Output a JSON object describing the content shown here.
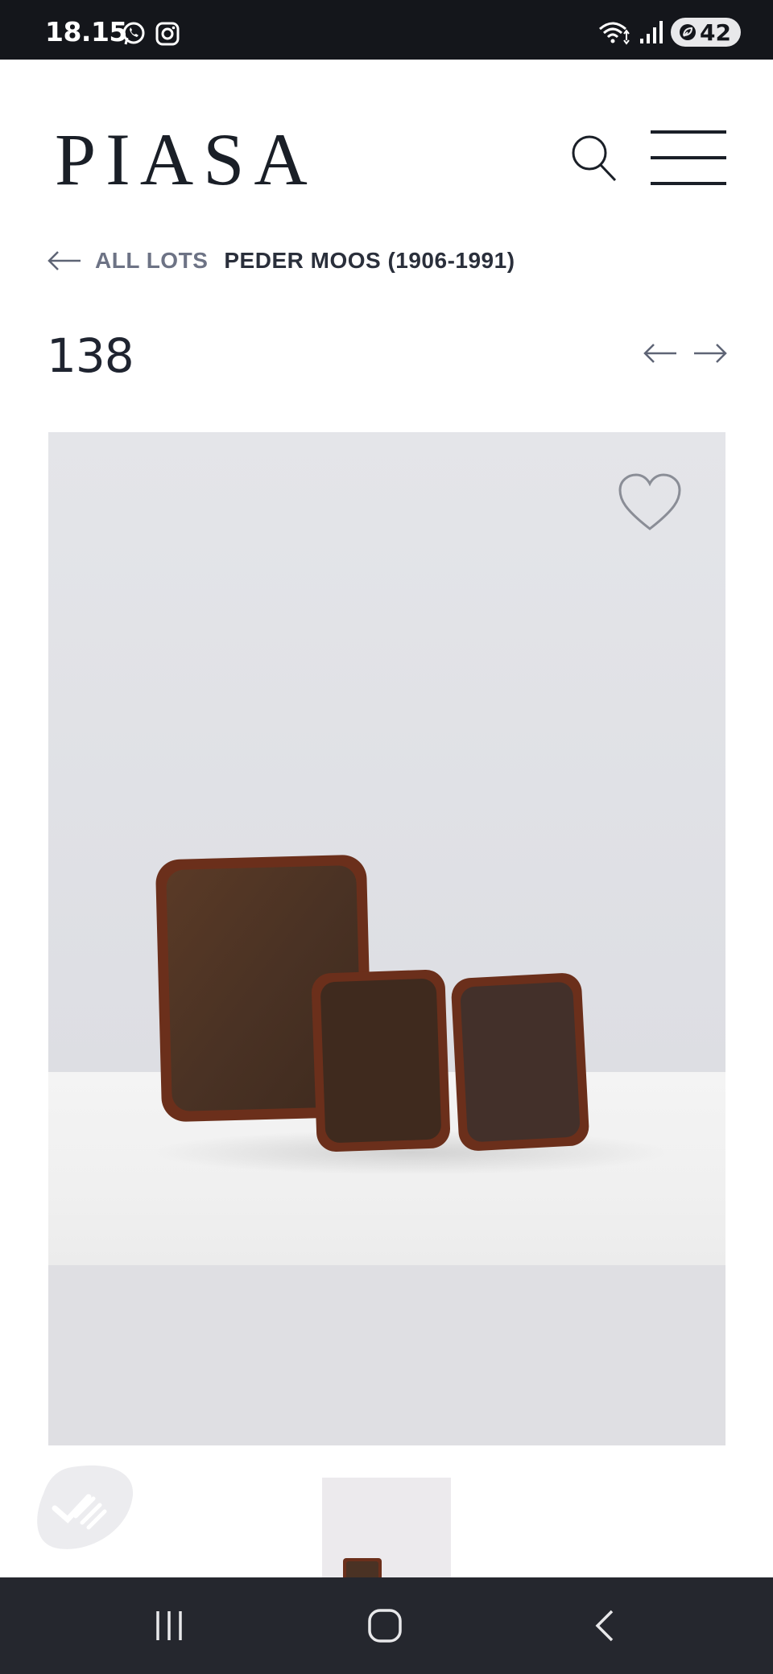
{
  "status_bar": {
    "time": "18.15",
    "app_icons": [
      "whatsapp-icon",
      "instagram-icon"
    ],
    "system_icons": [
      "wifi-icon",
      "signal-icon"
    ],
    "battery": "42"
  },
  "header": {
    "logo": "PIASA",
    "search_icon": "search-icon",
    "menu_icon": "hamburger-menu-icon"
  },
  "breadcrumb": {
    "back_label": "ALL LOTS",
    "artist": "PEDER MOOS (1906-1991)"
  },
  "lot": {
    "number": "138",
    "prev_icon": "arrow-left-icon",
    "next_icon": "arrow-right-icon"
  },
  "gallery": {
    "favorite_icon": "heart-icon",
    "main_image": "three wooden trays photograph",
    "thumbnails": 1
  },
  "colors": {
    "brand_dark": "#1a1f27",
    "muted_text": "#6d7385",
    "image_backdrop": "#dfdfe3",
    "system_bar": "#14161b",
    "nav_bar": "#25272e"
  }
}
